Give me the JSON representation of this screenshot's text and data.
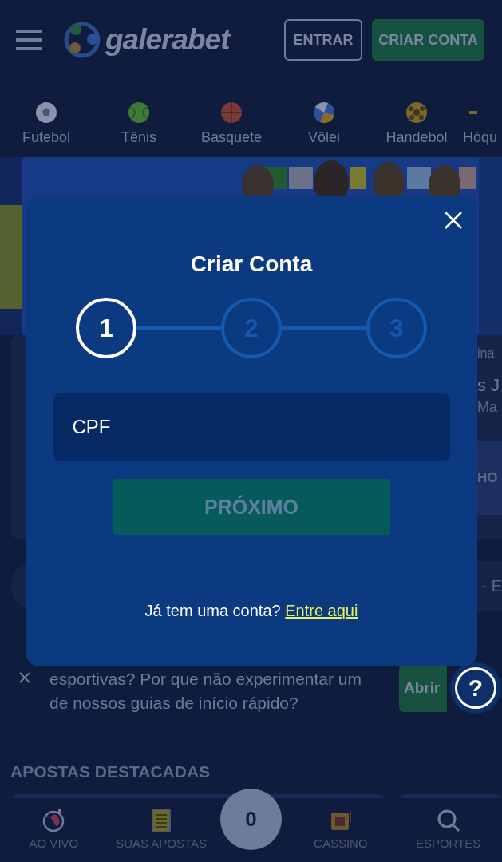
{
  "header": {
    "logo": "galerabet",
    "buttons": [
      {
        "label": "ENTRAR",
        "kind": "outline"
      },
      {
        "label": "CRIAR CONTA",
        "kind": "filled"
      }
    ]
  },
  "sports": [
    {
      "label": "Futebol",
      "kind": "soccer"
    },
    {
      "label": "Tênis",
      "kind": "tennis"
    },
    {
      "label": "Basquete",
      "kind": "basketball"
    },
    {
      "label": "Vôlei",
      "kind": "volleyball"
    },
    {
      "label": "Handebol",
      "kind": "handball"
    },
    {
      "label": "Hóqu",
      "kind": "hockey"
    }
  ],
  "background_fragments": {
    "card_top": "ina",
    "card_team": "s J",
    "card_sub": "Ma",
    "card_button": "HO",
    "bar": "- E"
  },
  "modal": {
    "title": "Criar Conta",
    "steps": [
      {
        "label": "1",
        "selected": true
      },
      {
        "label": "2",
        "selected": false
      },
      {
        "label": "3",
        "selected": false
      }
    ],
    "field": {
      "placeholder": "CPF"
    },
    "submit": {
      "label": "PRÓXIMO",
      "disabled": true
    },
    "footer": {
      "text": "Já tem uma conta?",
      "link": "Entre aqui"
    }
  },
  "notice": {
    "text": "esportivas? Por que não experimentar um de nossos guias de início rápido?",
    "button": "Abrir"
  },
  "help_button": "?",
  "section_title": "APOSTAS DESTACADAS",
  "bottom_nav": [
    {
      "label": "AO VIVO",
      "kind": "live"
    },
    {
      "label": "SUAS APOSTAS",
      "kind": "bets"
    },
    {
      "label": "CASSINO",
      "kind": "casino"
    },
    {
      "label": "ESPORTES",
      "kind": "search"
    }
  ],
  "betslip_count": "0"
}
